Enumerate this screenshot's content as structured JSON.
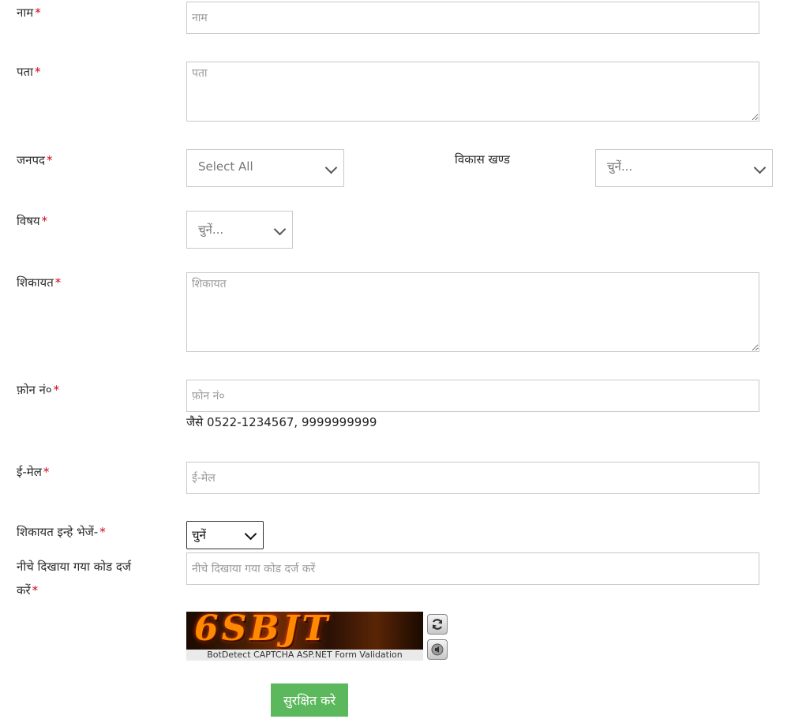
{
  "form": {
    "name": {
      "label": "नाम",
      "required": "*",
      "placeholder": "नाम"
    },
    "address": {
      "label": "पता",
      "required": "*",
      "placeholder": "पता"
    },
    "district": {
      "label": "जनपद",
      "required": "*",
      "selected": "Select All"
    },
    "block": {
      "label": "विकास खण्ड",
      "selected": "चुनें..."
    },
    "subject": {
      "label": "विषय",
      "required": "*",
      "selected": "चुनें..."
    },
    "complaint": {
      "label": "शिकायत",
      "required": "*",
      "placeholder": "शिकायत"
    },
    "phone": {
      "label": "फ़ोन नं०",
      "required": "*",
      "placeholder": "फ़ोन नं०",
      "hint": "जैसे 0522-1234567, 9999999999"
    },
    "email": {
      "label": "ई-मेल",
      "required": "*",
      "placeholder": "ई-मेल"
    },
    "send_to": {
      "label": "शिकायत इन्हे भेजें-",
      "required": "*",
      "selected": "चुनें"
    },
    "captcha": {
      "label_line1": "नीचे दिखाया गया कोड दर्ज",
      "label_line2": "करें",
      "required": "*",
      "placeholder": "नीचे दिखाया गया कोड दर्ज करें",
      "code_text": "6SBJT",
      "caption": "BotDetect CAPTCHA ASP.NET Form Validation"
    },
    "save_label": "सुरक्षित करे"
  },
  "icons": {
    "refresh": "refresh-icon",
    "sound": "speaker-icon"
  }
}
